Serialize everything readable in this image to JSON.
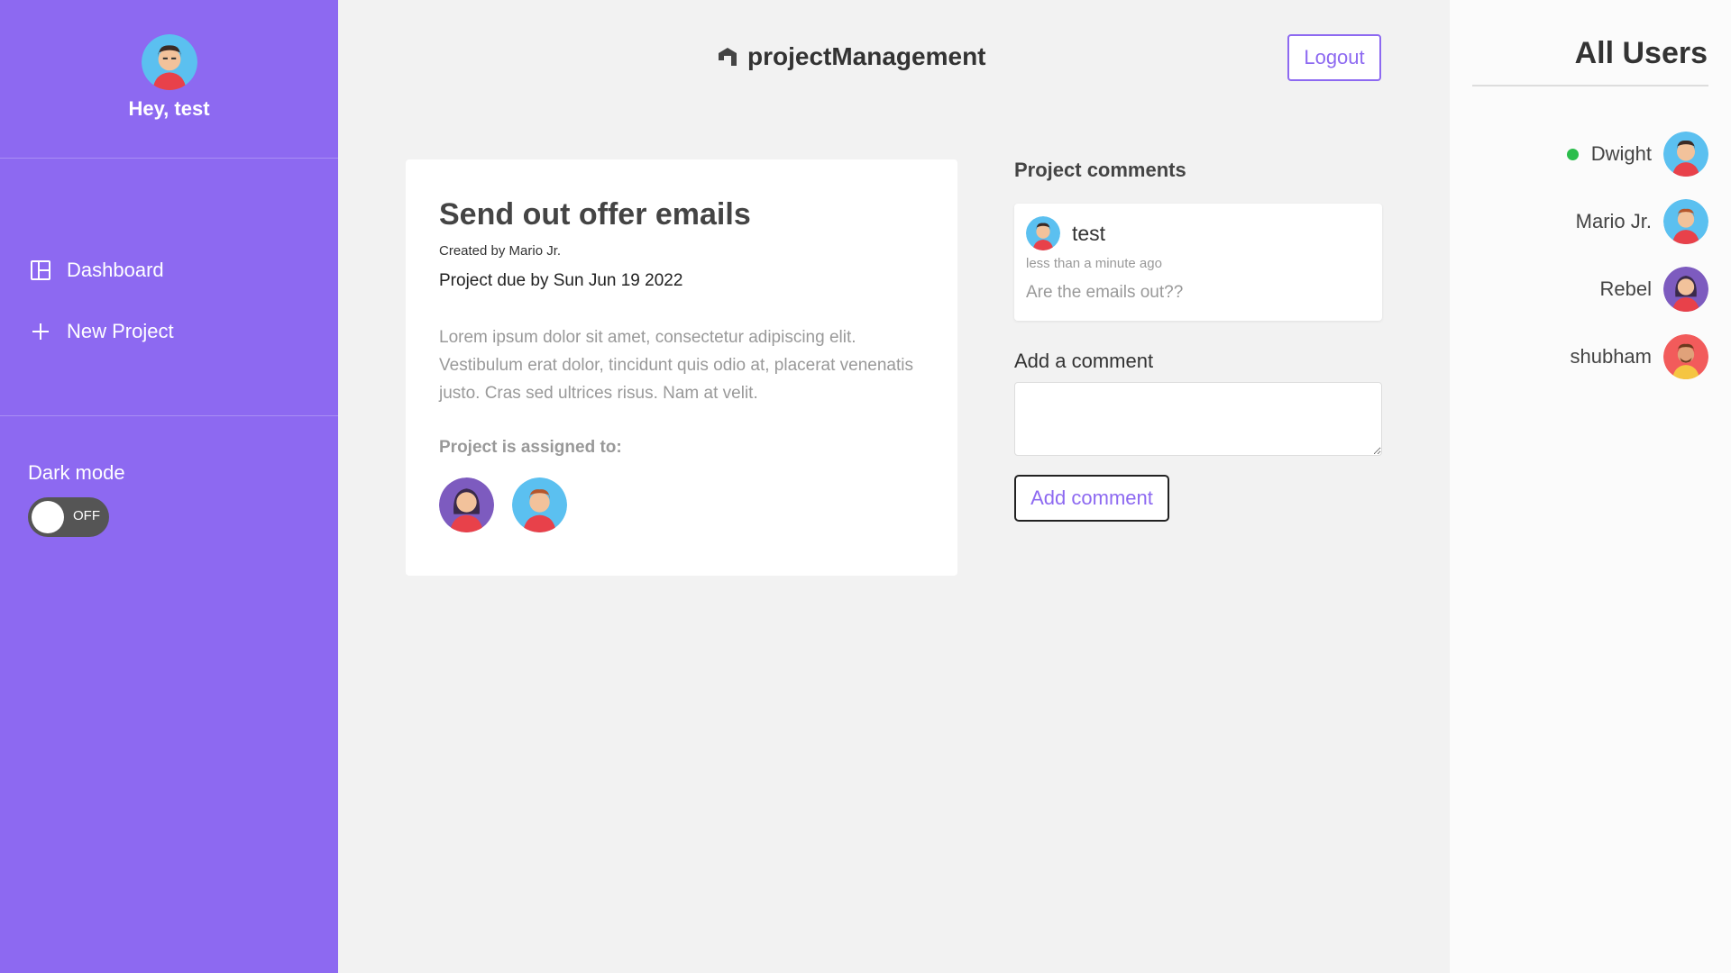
{
  "current_user": {
    "greeting": "Hey, test"
  },
  "sidebar": {
    "nav": [
      {
        "label": "Dashboard",
        "icon": "dashboard-icon"
      },
      {
        "label": "New Project",
        "icon": "plus-icon"
      }
    ],
    "dark_mode": {
      "label": "Dark mode",
      "state": "OFF"
    }
  },
  "header": {
    "brand": "projectManagement",
    "logout_label": "Logout"
  },
  "project": {
    "title": "Send out offer emails",
    "created_by": "Created by Mario Jr.",
    "due": "Project due by Sun Jun 19 2022",
    "description": "Lorem ipsum dolor sit amet, consectetur adipiscing elit. Vestibulum erat dolor, tincidunt quis odio at, placerat venenatis justo. Cras sed ultrices risus. Nam at velit.",
    "assigned_label": "Project is assigned to:"
  },
  "comments": {
    "heading": "Project comments",
    "items": [
      {
        "author": "test",
        "time": "less than a minute ago",
        "text": "Are the emails out??"
      }
    ],
    "add_label": "Add a comment",
    "add_button": "Add comment"
  },
  "users": {
    "heading": "All Users",
    "list": [
      {
        "name": "Dwight",
        "online": true
      },
      {
        "name": "Mario Jr.",
        "online": false
      },
      {
        "name": "Rebel",
        "online": false
      },
      {
        "name": "shubham",
        "online": false
      }
    ]
  },
  "colors": {
    "accent": "#8d69f1",
    "online": "#2bbd4c"
  }
}
